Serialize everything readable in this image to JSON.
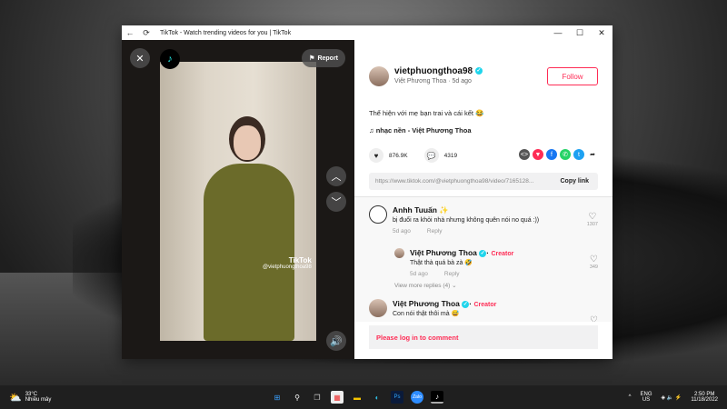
{
  "window": {
    "title": "TikTok - Watch trending videos for you | TikTok"
  },
  "video": {
    "report": "Report",
    "watermark_brand": "TikTok",
    "watermark_user": "@vietphuongthoa98"
  },
  "post": {
    "username": "vietphuongthoa98",
    "display_name": "Việt Phương Thoa",
    "age": "5d ago",
    "follow": "Follow",
    "description": "Thể hiện với mẹ bạn trai và cái kết 😂",
    "music": "nhạc nền - Việt Phương Thoa",
    "likes": "876.9K",
    "comments": "4319",
    "link": "https://www.tiktok.com/@vietphuongthoa98/video/7165128...",
    "copy_link": "Copy link"
  },
  "comments": [
    {
      "name": "Anhh Tuuấn ✨",
      "text": "bị đuổi ra khỏi nhà nhưng không quên nói no quá :))",
      "age": "5d ago",
      "reply": "Reply",
      "likes": "1307"
    },
    {
      "name": "Việt Phương Thoa",
      "badge": "Creator",
      "text": "Thật thà quá bà zà 🤣",
      "age": "5d ago",
      "reply": "Reply",
      "likes": "349"
    },
    {
      "name": "Việt Phương Thoa",
      "badge": "Creator",
      "text": "Con nói thật thôi mà 😅"
    }
  ],
  "view_more": "View more replies (4)",
  "login_prompt": "Please log in to comment",
  "taskbar": {
    "temp": "33°C",
    "weather": "Nhiều mây",
    "lang1": "ENG",
    "lang2": "US",
    "time": "2:50 PM",
    "date": "11/18/2022"
  }
}
